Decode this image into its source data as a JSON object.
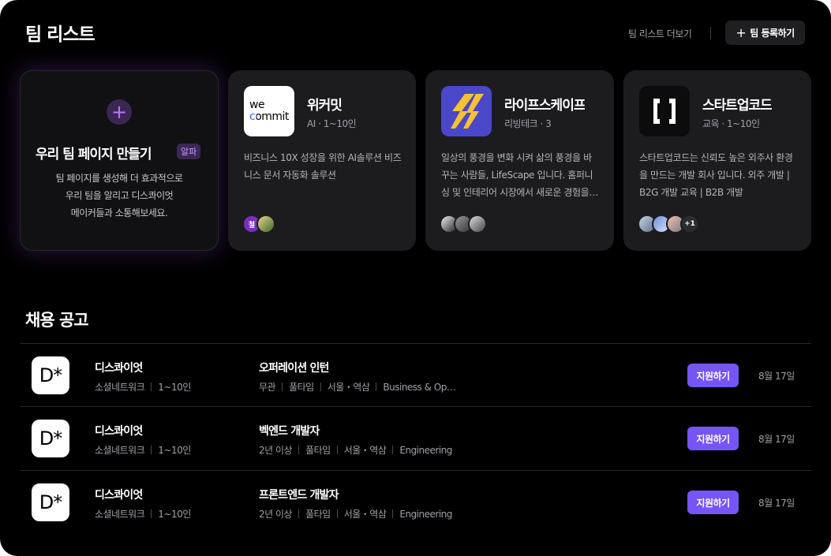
{
  "teams_section": {
    "title": "팀 리스트",
    "more_link": "팀 리스트 더보기",
    "register_label": "팀 등록하기",
    "make_card": {
      "title": "우리 팀 페이지 만들기",
      "badge": "알파",
      "desc_lines": [
        "팀 페이지를 생성해 더 효과적으로",
        "우리 팀을 알리고 디스콰이엇",
        "메이커들과 소통해보세요."
      ]
    },
    "teams": [
      {
        "name": "위커밋",
        "meta": "AI · 1~10인",
        "logo_text_1": "we",
        "logo_text_2": "commit",
        "desc": "비즈니스 10X 성장을 위한 AI솔루션 비즈니스 문서 자동화 솔루션",
        "avatar_1_text": "철"
      },
      {
        "name": "라이프스케이프",
        "meta": "리빙테크 · 3",
        "desc": "일상의 풍경을 변화 시켜 삶의 풍경을 바꾸는 사람들, LifeScape 입니다. 홈퍼니싱 및 인테리어 시장에서 새로운 경험을 만듭니다."
      },
      {
        "name": "스타트업코드",
        "meta": "교육 · 1~10인",
        "desc": "스타트업코드는 신뢰도 높은 외주사 환경을 만드는 개발 회사 입니다. 외주 개발 | B2G 개발 교육 | B2B 개발",
        "avatar_extra": "+1"
      }
    ]
  },
  "jobs_section": {
    "title": "채용 공고",
    "apply_label": "지원하기",
    "logo_text": "D*",
    "jobs": [
      {
        "company": "디스콰이엇",
        "company_type": "소셜네트워크",
        "company_size": "1~10인",
        "title": "오퍼레이션 인턴",
        "tags": [
          "무관",
          "풀타임",
          "서울・역삼",
          "Business & Operations"
        ],
        "date": "8월 17일"
      },
      {
        "company": "디스콰이엇",
        "company_type": "소셜네트워크",
        "company_size": "1~10인",
        "title": "벡엔드 개발자",
        "tags": [
          "2년 이상",
          "풀타임",
          "서울・역삼",
          "Engineering"
        ],
        "date": "8월 17일"
      },
      {
        "company": "디스콰이엇",
        "company_type": "소셜네트워크",
        "company_size": "1~10인",
        "title": "프론트엔드 개발자",
        "tags": [
          "2년 이상",
          "풀타임",
          "서울・역삼",
          "Engineering"
        ],
        "date": "8월 17일"
      }
    ]
  },
  "colors": {
    "background": "#000000",
    "card": "#1c1c1f",
    "accent": "#7455f5",
    "alpha_badge": "#3b2754"
  }
}
